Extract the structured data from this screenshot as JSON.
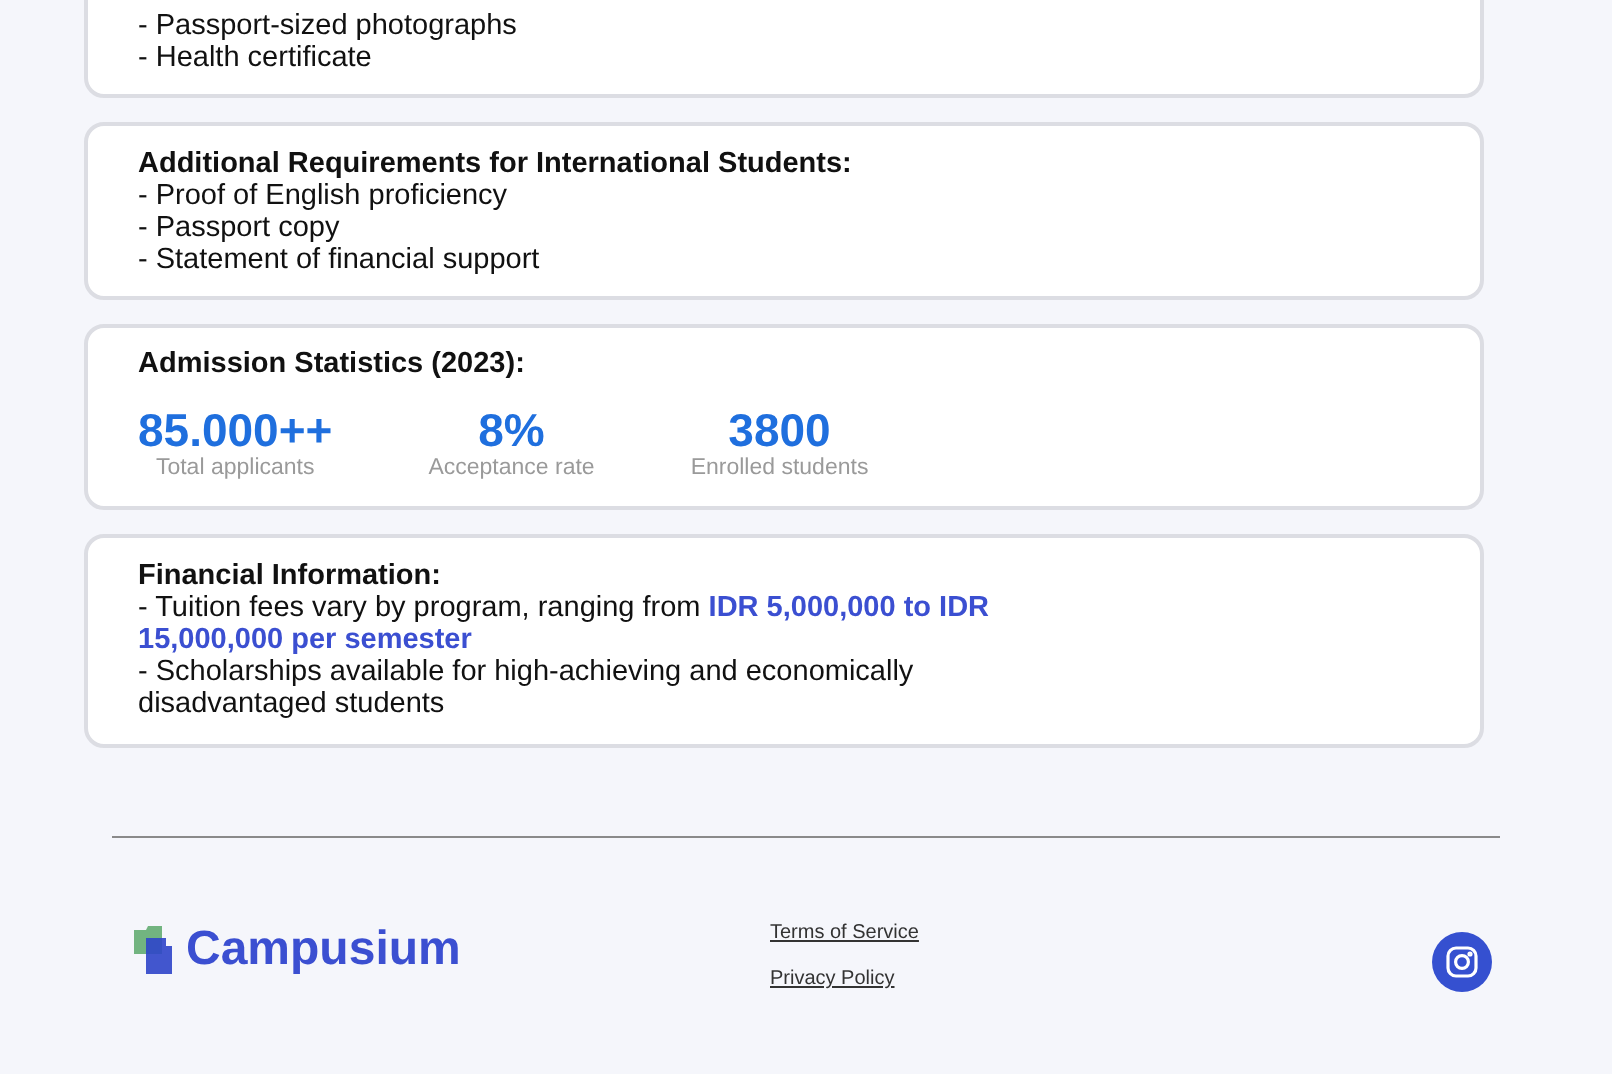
{
  "documents_card": {
    "items": [
      "- Passport-sized photographs",
      "- Health certificate"
    ]
  },
  "international_card": {
    "title": "Additional Requirements for International Students:",
    "items": [
      "- Proof of English proficiency",
      "- Passport copy",
      "- Statement of financial support"
    ]
  },
  "statistics_card": {
    "title": "Admission Statistics (2023):",
    "stats": [
      {
        "value": "85.000++",
        "label": "Total applicants"
      },
      {
        "value": "8%",
        "label": "Acceptance rate"
      },
      {
        "value": "3800",
        "label": "Enrolled students"
      }
    ]
  },
  "financial_card": {
    "title": "Financial Information:",
    "items": [
      "- Tuition fees vary by program, ranging from **IDR 5,000,000 to IDR 15,000,000 per semester**",
      "- Scholarships available for high-achieving and economically disadvantaged students"
    ]
  },
  "footer": {
    "logo": "Campusium",
    "links": [
      "Terms of Service",
      "Privacy Policy"
    ]
  }
}
